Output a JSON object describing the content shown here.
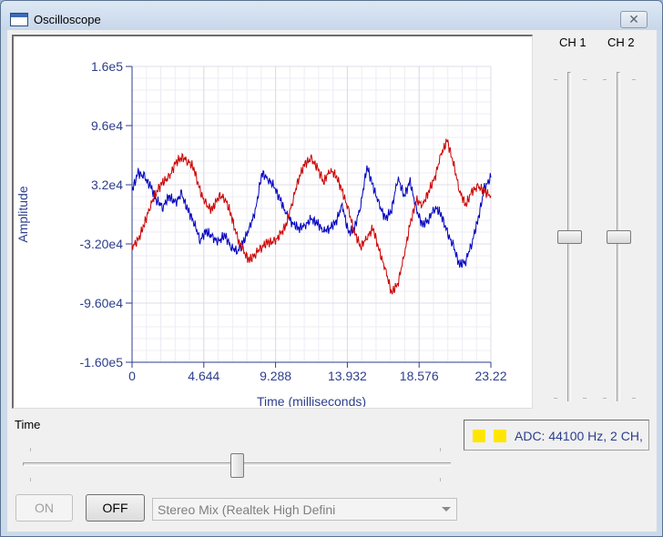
{
  "window": {
    "title": "Oscilloscope",
    "close_glyph": "✕"
  },
  "chart_data": {
    "type": "line",
    "xlabel": "Time (milliseconds)",
    "ylabel": "Amplitude",
    "xlim": [
      0,
      23.22
    ],
    "ylim": [
      -160000,
      160000
    ],
    "x_ticks": [
      "0",
      "4.644",
      "9.288",
      "13.932",
      "18.576",
      "23.22"
    ],
    "x_tick_values": [
      0,
      4.644,
      9.288,
      13.932,
      18.576,
      23.22
    ],
    "y_ticks": [
      "1.6e5",
      "9.6e4",
      "3.2e4",
      "-3.20e4",
      "-9.60e4",
      "-1.60e5"
    ],
    "y_tick_values": [
      160000,
      96000,
      32000,
      -32000,
      -96000,
      -160000
    ],
    "grid": true,
    "series": [
      {
        "color": "#0000c0",
        "x": [
          0,
          0.4,
          0.8,
          1.2,
          1.6,
          2.0,
          2.4,
          2.8,
          3.2,
          3.6,
          4.0,
          4.4,
          4.8,
          5.2,
          5.6,
          6.0,
          6.4,
          6.8,
          7.2,
          7.6,
          8.0,
          8.4,
          8.8,
          9.2,
          9.6,
          10.0,
          10.4,
          10.8,
          11.2,
          11.6,
          12.0,
          12.4,
          12.8,
          13.2,
          13.6,
          14.0,
          14.4,
          14.8,
          15.2,
          15.6,
          16.0,
          16.4,
          16.8,
          17.2,
          17.6,
          18.0,
          18.4,
          18.8,
          19.2,
          19.6,
          20.0,
          20.4,
          20.8,
          21.2,
          21.6,
          22.0,
          22.4,
          22.8,
          23.22
        ],
        "y": [
          26000,
          45000,
          40000,
          30000,
          15000,
          8000,
          20000,
          12000,
          22000,
          5000,
          -8000,
          -28000,
          -18000,
          -25000,
          -30000,
          -22000,
          -35000,
          -40000,
          -30000,
          -15000,
          5000,
          45000,
          38000,
          30000,
          15000,
          0,
          -10000,
          -15000,
          -12000,
          -5000,
          -10000,
          -18000,
          -15000,
          -8000,
          10000,
          -20000,
          -15000,
          10000,
          52000,
          30000,
          10000,
          -5000,
          5000,
          40000,
          20000,
          35000,
          5000,
          -12000,
          -5000,
          8000,
          0,
          -20000,
          -35000,
          -55000,
          -50000,
          -30000,
          -5000,
          28000,
          40000
        ]
      },
      {
        "color": "#cc0000",
        "x": [
          0,
          0.4,
          0.8,
          1.2,
          1.6,
          2.0,
          2.4,
          2.8,
          3.2,
          3.6,
          4.0,
          4.4,
          4.8,
          5.2,
          5.6,
          6.0,
          6.4,
          6.8,
          7.2,
          7.6,
          8.0,
          8.4,
          8.8,
          9.2,
          9.6,
          10.0,
          10.4,
          10.8,
          11.2,
          11.6,
          12.0,
          12.4,
          12.8,
          13.2,
          13.6,
          14.0,
          14.4,
          14.8,
          15.2,
          15.6,
          16.0,
          16.4,
          16.8,
          17.2,
          17.6,
          18.0,
          18.4,
          18.8,
          19.2,
          19.6,
          20.0,
          20.4,
          20.8,
          21.2,
          21.6,
          22.0,
          22.4,
          22.8,
          23.22
        ],
        "y": [
          -35000,
          -28000,
          -10000,
          10000,
          25000,
          35000,
          40000,
          55000,
          62000,
          58000,
          50000,
          25000,
          10000,
          5000,
          20000,
          18000,
          0,
          -25000,
          -40000,
          -50000,
          -42000,
          -35000,
          -30000,
          -30000,
          -22000,
          -10000,
          15000,
          40000,
          55000,
          60000,
          50000,
          35000,
          48000,
          42000,
          25000,
          5000,
          -20000,
          -35000,
          -25000,
          -15000,
          -40000,
          -60000,
          -85000,
          -75000,
          -45000,
          -10000,
          15000,
          10000,
          25000,
          40000,
          65000,
          80000,
          55000,
          25000,
          10000,
          25000,
          30000,
          25000,
          20000
        ]
      }
    ]
  },
  "channels": {
    "ch1_label": "CH 1",
    "ch2_label": "CH 2",
    "ch1_level": 0.5,
    "ch2_level": 0.5
  },
  "time_control": {
    "label": "Time",
    "position": 0.5
  },
  "status": {
    "text": "ADC: 44100 Hz, 2 CH,",
    "swatch_color": "#ffe600"
  },
  "controls": {
    "on_label": "ON",
    "off_label": "OFF",
    "device_selected": "Stereo Mix (Realtek High Defini"
  }
}
